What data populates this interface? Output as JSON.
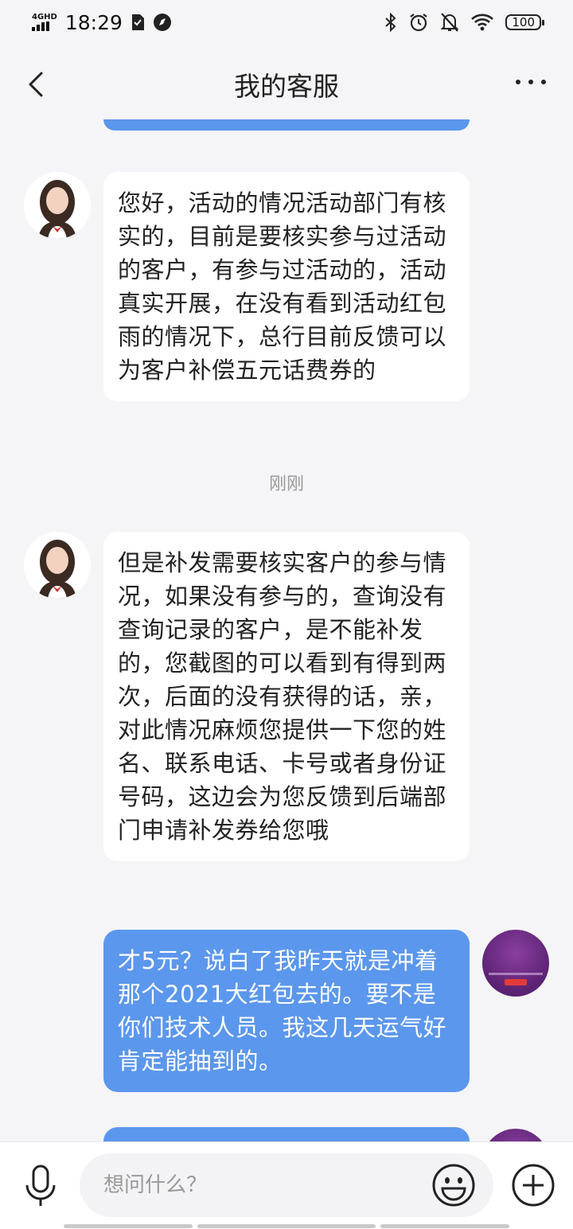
{
  "status_bar": {
    "network": "4GHD",
    "time": "18:29",
    "battery": "100"
  },
  "header": {
    "title": "我的客服"
  },
  "messages": [
    {
      "from": "agent",
      "text": "您好，活动的情况活动部门有核实的，目前是要核实参与过活动的客户，有参与过活动的，活动真实开展，在没有看到活动红包雨的情况下，总行目前反馈可以为客户补偿五元话费券的"
    },
    {
      "from": "agent",
      "text": "但是补发需要核实客户的参与情况，如果没有参与的，查询没有查询记录的客户，是不能补发的，您截图的可以看到有得到两次，后面的没有获得的话，亲，对此情况麻烦您提供一下您的姓名、联系电话、卡号或者身份证号码，这边会为您反馈到后端部门申请补发券给您哦"
    },
    {
      "from": "user",
      "text": "才5元？说白了我昨天就是冲着那个2021大红包去的。要不是你们技术人员。我这几天运气好肯定能抽到的。"
    }
  ],
  "timestamp": "刚刚",
  "input": {
    "placeholder": "想问什么？"
  },
  "colors": {
    "user_bubble": "#5b97ec",
    "agent_bubble": "#ffffff",
    "background": "#f5f5f7"
  },
  "icons": [
    "back-arrow-icon",
    "more-icon",
    "mic-icon",
    "emoji-icon",
    "plus-icon"
  ]
}
